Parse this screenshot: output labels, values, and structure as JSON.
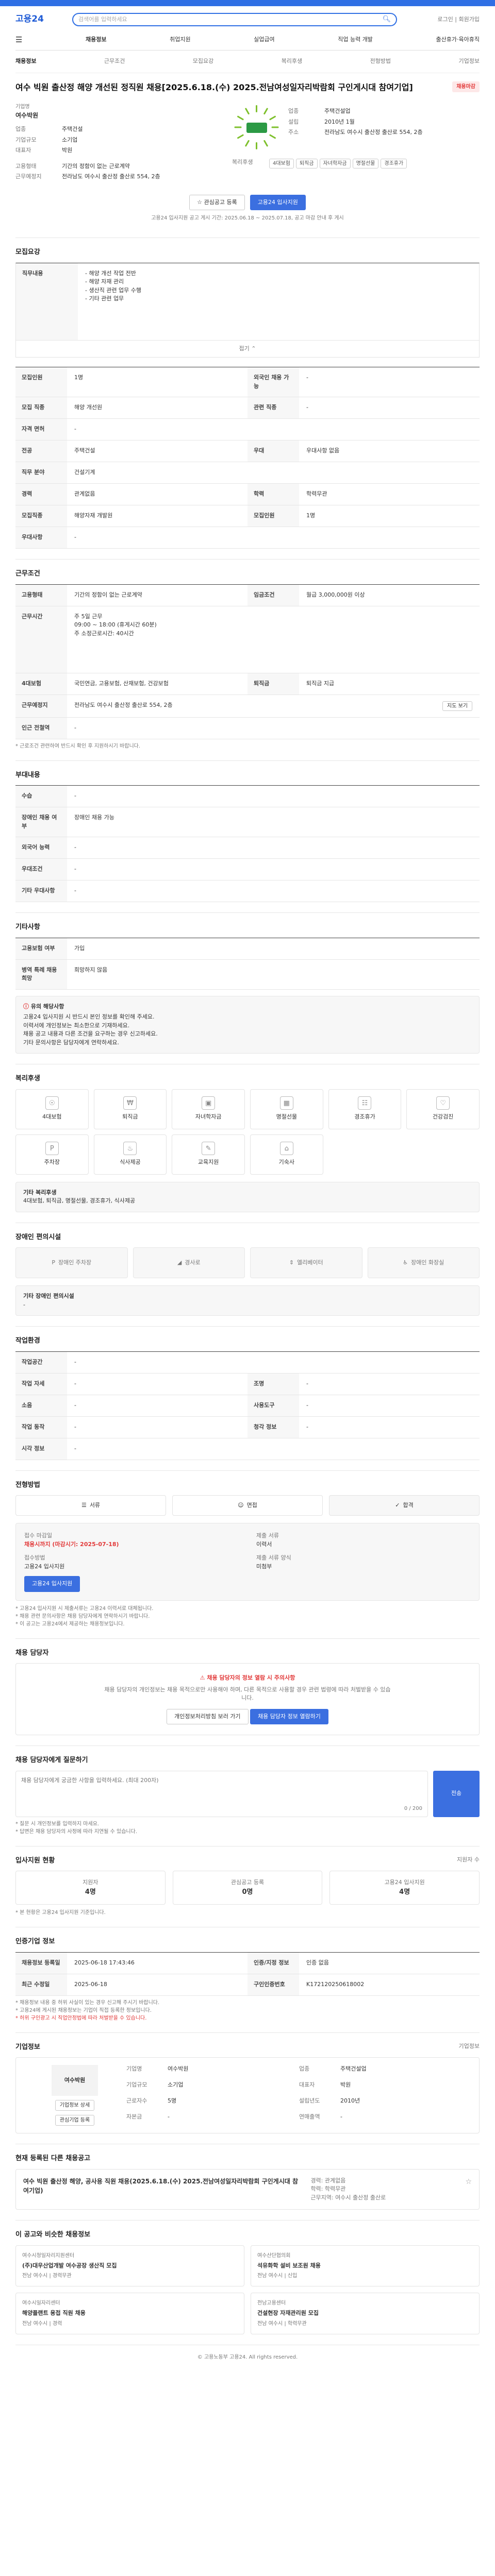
{
  "brand": {
    "logo": "고용24",
    "search_placeholder": "검색어를 입력하세요",
    "util": "로그인 | 회원가입"
  },
  "nav": {
    "items": [
      "채용정보",
      "취업지원",
      "실업급여",
      "직업 능력 개발",
      "출산휴가·육아휴직"
    ]
  },
  "tabs": [
    "채용정보",
    "근무조건",
    "모집요강",
    "복리후생",
    "전형방법",
    "기업정보"
  ],
  "job": {
    "title": "여수 빅원 출산정 해양 개선된 정직원 채용[2025.6.18.(수) 2025.전남여성일자리박람회 구인게시대 참여기업]",
    "badge": "채용마감",
    "company_label": "기업명",
    "company": "여수박원",
    "company_rows": [
      {
        "k": "업종",
        "v": "주택건설"
      },
      {
        "k": "기업규모",
        "v": "소기업"
      },
      {
        "k": "대표자",
        "v": "박원"
      }
    ],
    "summary_rows": [
      {
        "k": "고용형태",
        "v": "기간의 정함이 없는 근로계약"
      },
      {
        "k": "근무예정지",
        "v": "전라남도 여수시 출산정 출산로 554, 2층"
      }
    ],
    "company_side": [
      {
        "k": "업종",
        "v": "주택건설업"
      },
      {
        "k": "설립",
        "v": "2010년 1월"
      },
      {
        "k": "주소",
        "v": "전라남도 여수시 출산정 출산로 554, 2층"
      }
    ],
    "benefits_label": "복리후생",
    "benefit_chips": [
      "4대보험",
      "퇴직금",
      "자녀학자금",
      "명절선물",
      "경조휴가"
    ],
    "share": "관심공고 등록",
    "apply": "고용24 입사지원",
    "notice": "고용24 입사지원 공고 게시 기간: 2025.06.18 ~ 2025.07.18, 공고 마감 안내 후 게시"
  },
  "recruit": {
    "title": "모집요강",
    "rows": [
      {
        "k": "모집직종",
        "v": "해양자재 개발원"
      },
      {
        "k": "직무내용",
        "v": "- 해양 개선 작업 전반\n- 해양 자재 관리\n- 생산직 관련 업무 수행\n- 기타 관련 업무"
      },
      {
        "k": "경력",
        "v": "관계없음"
      },
      {
        "k": "학력",
        "v": "학력무관"
      },
      {
        "k": "모집인원",
        "v": "1명"
      },
      {
        "k": "우대사항",
        "v": "-"
      }
    ],
    "grid": [
      {
        "k": "모집인원",
        "v": "1명"
      },
      {
        "k": "외국인 채용 가능",
        "v": "-"
      },
      {
        "k": "모집 직종",
        "v": "해양 개선원"
      },
      {
        "k": "관련 직종",
        "v": "-"
      },
      {
        "k": "자격 면허",
        "v": "-"
      },
      {
        "k": "전공",
        "v": "주택건설"
      },
      {
        "k": "우대",
        "v": "우대사항 없음"
      },
      {
        "k": "직무 분야",
        "v": "건설기계"
      }
    ]
  },
  "conditions": {
    "title": "근무조건",
    "rows": [
      {
        "k": "고용형태",
        "v": "기간의 정함이 없는 근로계약"
      },
      {
        "k": "임금조건",
        "v": "월급 3,000,000원 이상"
      },
      {
        "k": "근무시간",
        "v": "주 5일 근무\n09:00 ~ 18:00 (휴게시간 60분)\n주 소정근로시간: 40시간"
      },
      {
        "k": "4대보험",
        "v": "국민연금, 고용보험, 산재보험, 건강보험"
      },
      {
        "k": "근무예정지",
        "v": "전라남도 여수시 출산정 출산로 554, 2층"
      },
      {
        "k": "퇴직금",
        "v": "퇴직금 지급"
      },
      {
        "k": "인근 전철역",
        "v": "-"
      }
    ],
    "notice": "* 근로조건 관련하여 반드시 확인 후 지원하시기 바랍니다."
  },
  "extra": {
    "title": "부대내용",
    "rows": [
      {
        "k": "수습",
        "v": "-"
      },
      {
        "k": "장애인 채용 여부",
        "v": "장애인 채용 가능"
      },
      {
        "k": "외국어 능력",
        "v": "-"
      },
      {
        "k": "우대조건",
        "v": "-"
      },
      {
        "k": "기타 우대사항",
        "v": "-"
      }
    ]
  },
  "other": {
    "title": "기타사항",
    "rows": [
      {
        "k": "고용보험 여부",
        "v": "가입"
      },
      {
        "k": "병역 특례 채용 희망",
        "v": "희망하지 않음"
      }
    ],
    "notice_title": "유의 해당사항",
    "notices": [
      "고용24 입사지원 시 반드시 본인 정보를 확인해 주세요.",
      "이력서에 개인정보는 최소한으로 기재하세요.",
      "채용 공고 내용과 다른 조건을 요구하는 경우 신고하세요.",
      "기타 문의사항은 담당자에게 연락하세요."
    ]
  },
  "welfare": {
    "title": "복리후생",
    "items": [
      "4대보험",
      "퇴직금",
      "자녀학자금",
      "명절선물",
      "경조휴가",
      "건강검진",
      "주차장",
      "식사제공",
      "교육지원",
      "기숙사"
    ],
    "subtitle": "기타 복리후생",
    "detail": "4대보험, 퇴직금, 명절선물, 경조휴가, 식사제공"
  },
  "disability": {
    "title": "장애인 편의시설",
    "items": [
      "장애인 주차장",
      "경사로",
      "엘리베이터",
      "장애인 화장실"
    ],
    "subtitle": "기타 장애인 편의시설",
    "detail": "-"
  },
  "workenv": {
    "title": "작업환경",
    "rows": [
      {
        "k": "작업공간",
        "v": "-"
      },
      {
        "k": "작업 자세",
        "v": "-"
      },
      {
        "k": "조명",
        "v": "-"
      },
      {
        "k": "소음",
        "v": "-"
      },
      {
        "k": "사용도구",
        "v": "-"
      },
      {
        "k": "작업 동작",
        "v": "-"
      },
      {
        "k": "청각 정보",
        "v": "-"
      },
      {
        "k": "시각 정보",
        "v": "-"
      }
    ]
  },
  "process": {
    "title": "전형방법",
    "steps": [
      "서류",
      "면접",
      "합격"
    ],
    "side": [
      {
        "k": "접수 마감일",
        "v": "채용시까지 (마감시기: 2025-07-18)"
      },
      {
        "k": "제출 서류",
        "v": "이력서"
      },
      {
        "k": "접수방법",
        "v": "고용24 입사지원"
      },
      {
        "k": "제출 서류 양식",
        "v": "미첨부"
      }
    ],
    "apply": "고용24 입사지원",
    "notes": [
      "* 고용24 입사지원 시 제출서류는 고용24 이력서로 대체됩니다.",
      "* 채용 관련 문의사항은 채용 담당자에게 연락하시기 바랍니다.",
      "* 이 공고는 고용24에서 제공하는 채용정보입니다."
    ]
  },
  "contact": {
    "title": "채용 담당자",
    "alert": "채용 담당자의 정보 열람 시 주의사항",
    "body": "채용 담당자의 개인정보는 채용 목적으로만 사용해야 하며, 다른 목적으로 사용할 경우 관련 법령에 따라 처벌받을 수 있습니다.",
    "btn1": "개인정보처리방침 보러 가기",
    "btn2": "채용 담당자 정보 열람하기"
  },
  "inquiry": {
    "title": "채용 담당자에게 질문하기",
    "placeholder": "채용 담당자에게 궁금한 사항을 입력하세요. (최대 200자)",
    "counter": "0 / 200",
    "send": "전송",
    "notes": [
      "* 질문 시 개인정보를 입력하지 마세요.",
      "* 답변은 채용 담당자의 사정에 따라 지연될 수 있습니다."
    ]
  },
  "status": {
    "title": "입사지원 현황",
    "more": "지원자 수",
    "cards": [
      {
        "k": "지원자",
        "v": "4명"
      },
      {
        "k": "관심공고 등록",
        "v": "0명"
      },
      {
        "k": "고용24 입사지원",
        "v": "4명"
      }
    ],
    "note": "* 본 현황은 고용24 입사지원 기준입니다."
  },
  "origin": {
    "title": "인증기업 정보",
    "rows": [
      {
        "k": "채용정보 등록일",
        "v": "2025-06-18 17:43:46"
      },
      {
        "k": "인증/지정 정보",
        "v": "인증 없음"
      },
      {
        "k": "최근 수정일",
        "v": "2025-06-18"
      },
      {
        "k": "구인인증번호",
        "v": "K172120250618002"
      }
    ],
    "notes": [
      "* 채용정보 내용 중 허위 사실이 있는 경우 신고해 주시기 바랍니다.",
      "* 고용24에 게시된 채용정보는 기업이 직접 등록한 정보입니다.",
      "* 허위 구인광고 시 직업안정법에 따라 처벌받을 수 있습니다."
    ]
  },
  "companyinfo": {
    "title": "기업정보",
    "name": "여수박원",
    "rows": [
      {
        "k": "기업명",
        "v": "여수박원"
      },
      {
        "k": "업종",
        "v": "주택건설업"
      },
      {
        "k": "기업규모",
        "v": "소기업"
      },
      {
        "k": "대표자",
        "v": "박원"
      },
      {
        "k": "근로자수",
        "v": "5명"
      },
      {
        "k": "설립년도",
        "v": "2010년"
      },
      {
        "k": "자본금",
        "v": "-"
      },
      {
        "k": "연매출액",
        "v": "-"
      }
    ],
    "btn1": "기업정보 상세",
    "btn2": "관심기업 등록",
    "more": "기업정보"
  },
  "same_company": {
    "title": "현재 등록된 다른 채용공고",
    "item_title": "여수 빅원 출산정 해양, 공사용 직원 채용(2025.6.18.(수) 2025.전남여성일자리박람회 구인게시대 참여기업)",
    "item_rows": [
      "경력: 관계없음",
      "학력: 학력무관",
      "근무지역: 여수시 출산정 출산로"
    ]
  },
  "similar": {
    "title": "이 공고와 비슷한 채용정보",
    "items": [
      {
        "co": "여수시청일자리지원센터",
        "title": "(주)대우산업개발 여수공장 생산직 모집",
        "meta": "전남 여수시 | 경력무관"
      },
      {
        "co": "여수산단협의회",
        "title": "석유화학 설비 보조원 채용",
        "meta": "전남 여수시 | 신입"
      },
      {
        "co": "여수시일자리센터",
        "title": "해양플랜트 용접 직원 채용",
        "meta": "전남 여수시 | 경력"
      },
      {
        "co": "전남고용센터",
        "title": "건설현장 자재관리원 모집",
        "meta": "전남 여수시 | 학력무관"
      }
    ]
  },
  "footer": "© 고용노동부 고용24. All rights reserved."
}
